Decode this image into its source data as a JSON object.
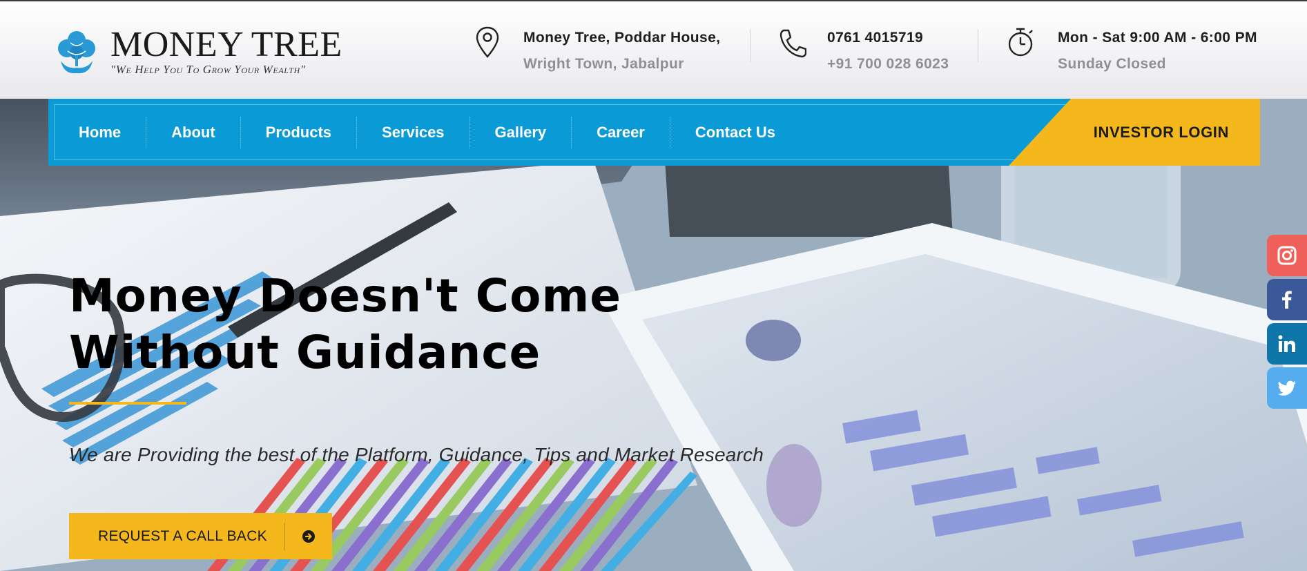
{
  "brand": {
    "name": "MONEY TREE",
    "tagline": "\"We Help You To Grow Your Wealth\""
  },
  "contact": {
    "address_line1": "Money Tree, Poddar House,",
    "address_line2": "Wright Town, Jabalpur",
    "phone1": "0761 4015719",
    "phone2": "+91 700 028 6023",
    "hours": "Mon - Sat 9:00 AM - 6:00 PM",
    "closed": "Sunday Closed"
  },
  "nav": {
    "items": [
      {
        "label": "Home"
      },
      {
        "label": "About"
      },
      {
        "label": "Products"
      },
      {
        "label": "Services"
      },
      {
        "label": "Gallery"
      },
      {
        "label": "Career"
      },
      {
        "label": "Contact Us"
      }
    ],
    "login_label": "INVESTOR LOGIN"
  },
  "hero": {
    "title_line1": "Money Doesn't Come",
    "title_line2": "Without Guidance",
    "subtitle": "We are Providing the best of the Platform, Guidance, Tips and Market Research",
    "cta_label": "REQUEST A CALL BACK"
  },
  "social": [
    {
      "icon": "instagram-icon",
      "color": "#f0605a"
    },
    {
      "icon": "facebook-icon",
      "color": "#3b5998"
    },
    {
      "icon": "linkedin-icon",
      "color": "#0e76a8"
    },
    {
      "icon": "twitter-icon",
      "color": "#55acee"
    }
  ],
  "colors": {
    "primary_blue": "#0a9bd6",
    "accent_yellow": "#f4b81c"
  }
}
